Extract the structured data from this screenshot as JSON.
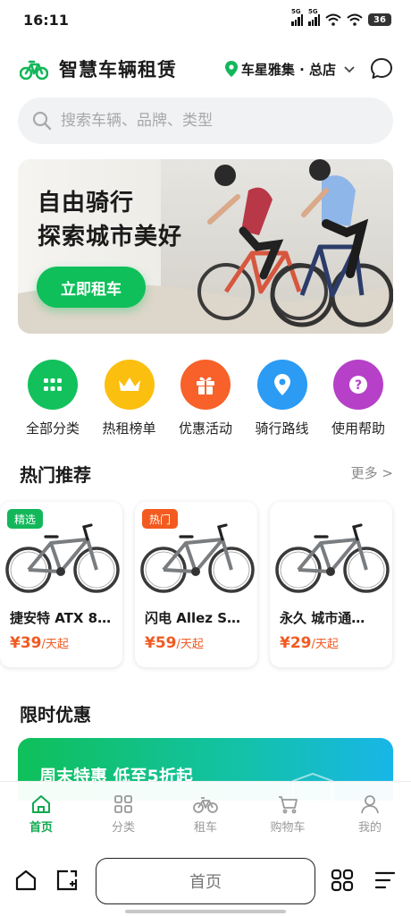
{
  "status": {
    "time": "16:11",
    "signal1": "5G",
    "signal2": "5G",
    "battery": "36"
  },
  "header": {
    "app_title": "智慧车辆租赁",
    "location": "车星雅集 · 总店",
    "icons": {
      "logo": "bike-logo-icon",
      "location": "location-pin-icon",
      "chevron": "chevron-down-icon",
      "message": "chat-bubble-icon"
    }
  },
  "search": {
    "placeholder": "搜索车辆、品牌、类型"
  },
  "banner": {
    "line1": "自由骑行",
    "line2": "探索城市美好",
    "button": "立即租车"
  },
  "categories": [
    {
      "label": "全部分类",
      "icon": "grid-icon",
      "color": "#12c15c"
    },
    {
      "label": "热租榜单",
      "icon": "crown-icon",
      "color": "#fbbf0f"
    },
    {
      "label": "优惠活动",
      "icon": "gift-icon",
      "color": "#f8612a"
    },
    {
      "label": "骑行路线",
      "icon": "location-pin-icon",
      "color": "#2b9bf4"
    },
    {
      "label": "使用帮助",
      "icon": "help-icon",
      "color": "#b640c8"
    }
  ],
  "hot": {
    "title": "热门推荐",
    "more": "更多 >",
    "items": [
      {
        "tag": "精选",
        "tag_color": "#12b75a",
        "name": "捷安特 ATX 8…",
        "price": "¥39",
        "unit": "/天起"
      },
      {
        "tag": "热门",
        "tag_color": "#f35a1f",
        "name": "闪电 Allez S…",
        "price": "¥59",
        "unit": "/天起"
      },
      {
        "tag": "",
        "tag_color": "",
        "name": "永久 城市通…",
        "price": "¥29",
        "unit": "/天起"
      }
    ]
  },
  "deals": {
    "title": "限时优惠",
    "promo_title": "周末特惠 低至5折起"
  },
  "tabbar": {
    "items": [
      {
        "label": "首页",
        "icon": "home-icon",
        "active": true
      },
      {
        "label": "分类",
        "icon": "grid-icon",
        "active": false
      },
      {
        "label": "租车",
        "icon": "bike-icon",
        "active": false
      },
      {
        "label": "购物车",
        "icon": "cart-icon",
        "active": false
      },
      {
        "label": "我的",
        "icon": "user-icon",
        "active": false
      }
    ]
  },
  "browser": {
    "address": "首页",
    "icons": [
      "home-icon",
      "share-icon",
      "tabs-grid-icon",
      "menu-icon"
    ]
  },
  "colors": {
    "accent": "#0fbf5a",
    "price": "#f05a22"
  }
}
